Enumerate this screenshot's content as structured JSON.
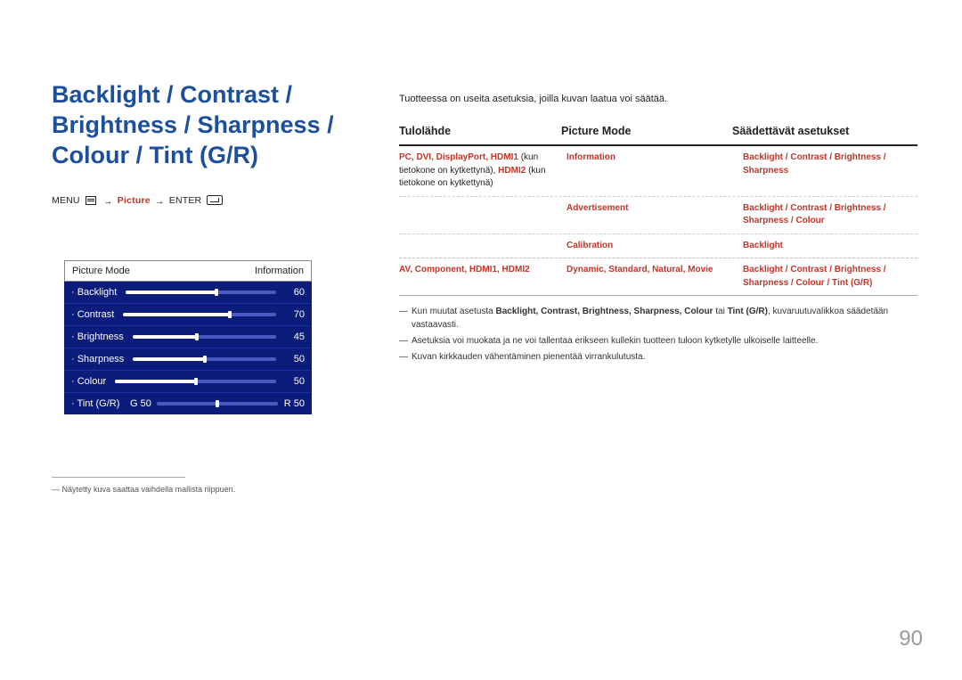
{
  "title": "Backlight / Contrast / Brightness / Sharpness / Colour / Tint (G/R)",
  "path": {
    "menu": "MENU",
    "arrow": "→",
    "picture": "Picture",
    "enter": "ENTER"
  },
  "osd": {
    "header_left": "Picture Mode",
    "header_right": "Information",
    "rows": [
      {
        "label": "Backlight",
        "value": "60",
        "pct": 60
      },
      {
        "label": "Contrast",
        "value": "70",
        "pct": 70
      },
      {
        "label": "Brightness",
        "value": "45",
        "pct": 45
      },
      {
        "label": "Sharpness",
        "value": "50",
        "pct": 50
      },
      {
        "label": "Colour",
        "value": "50",
        "pct": 50
      }
    ],
    "tint": {
      "label": "Tint (G/R)",
      "g": "G 50",
      "r": "R 50"
    }
  },
  "left_footnote": "―   Näytetty kuva saattaa vaihdella mallista riippuen.",
  "right": {
    "intro": "Tuotteessa on useita asetuksia, joilla kuvan laatua voi säätää.",
    "th": {
      "c1": "Tulolähde",
      "c2": "Picture Mode",
      "c3": "Säädettävät asetukset"
    },
    "group1": {
      "c1_a": "PC, DVI, DisplayPort, HDMI1",
      "c1_a_tail": " (kun tietokone on kytkettynä), ",
      "c1_b": "HDMI2",
      "c1_b_tail": " (kun tietokone on kytkettynä)",
      "rows": [
        {
          "c2": "Information",
          "c3": "Backlight / Contrast / Brightness / Sharpness"
        },
        {
          "c2": "Advertisement",
          "c3": "Backlight / Contrast / Brightness / Sharpness / Colour"
        },
        {
          "c2": "Calibration",
          "c3": "Backlight"
        }
      ]
    },
    "group2": {
      "c1": "AV, Component, HDMI1, HDMI2",
      "c2": "Dynamic, Standard, Natural, Movie",
      "c3": "Backlight / Contrast / Brightness / Sharpness / Colour / Tint (G/R)"
    },
    "bullets": [
      {
        "pre": "Kun muutat asetusta ",
        "bolds": "Backlight, Contrast, Brightness, Sharpness, Colour",
        "mid": "  tai ",
        "bold2": "Tint (G/R)",
        "post": ", kuvaruutuvalikkoa säädetään vastaavasti."
      },
      {
        "text": "Asetuksia voi muokata ja ne voi tallentaa erikseen kullekin tuotteen tuloon kytketylle ulkoiselle laitteelle."
      },
      {
        "text": "Kuvan kirkkauden vähentäminen pienentää virrankulutusta."
      }
    ]
  },
  "page_number": "90"
}
